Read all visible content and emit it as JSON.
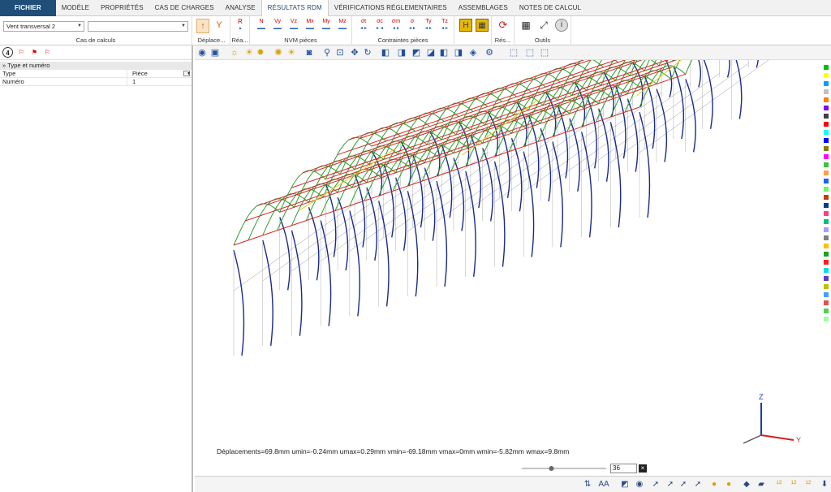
{
  "menu": {
    "tabs": [
      {
        "label": "FICHIER"
      },
      {
        "label": "MODÈLE"
      },
      {
        "label": "PROPRIÉTÉS"
      },
      {
        "label": "CAS DE CHARGES"
      },
      {
        "label": "ANALYSE"
      },
      {
        "label": "RÉSULTATS RDM"
      },
      {
        "label": "VÉRIFICATIONS RÉGLEMENTAIRES"
      },
      {
        "label": "ASSEMBLAGES"
      },
      {
        "label": "NOTES DE CALCUL"
      }
    ],
    "active_index": 5
  },
  "ribbon": {
    "load_case_combo": "Vent transversal 2",
    "second_combo": "",
    "groups": {
      "cas": "Cas de calculs",
      "deplacements": "Déplace...",
      "reactions": "Réa...",
      "nvm": "NVM pièces",
      "contraintes": "Contraintes pièces",
      "results": "Rés...",
      "outils": "Outils"
    },
    "nvm_icons": [
      "N",
      "Vy",
      "Vz",
      "Mx",
      "My",
      "Mz"
    ],
    "stress_icons": [
      "σt",
      "σc",
      "σm",
      "σ",
      "Ty",
      "Tz"
    ]
  },
  "left_panel": {
    "header": "Type et numéro",
    "rows": [
      {
        "key": "Type",
        "value": "Pièce"
      },
      {
        "key": "Numéro",
        "value": "1"
      }
    ]
  },
  "viewport": {
    "status": "Déplacements=69.8mm  umin=-0.24mm  umax=0.29mm  vmin=-69.18mm  vmax=0mm  wmin=-5.82mm  wmax=9.8mm",
    "zoom_value": "36",
    "axes": {
      "x": "Y",
      "z": "Z"
    },
    "slider_fraction": 0.35
  },
  "colors": {
    "rafter": "#2e9e2e",
    "purlin": "#d42a2a",
    "column": "#1a2a8a",
    "bracing": "#e0d020",
    "undeformed": "#9a9a9a"
  },
  "palette": [
    "#00c000",
    "#ffff00",
    "#00a0ff",
    "#c0c0c0",
    "#ff8000",
    "#8000ff",
    "#404040",
    "#ff0000",
    "#00ffff",
    "#0000ff",
    "#808000",
    "#ff00ff",
    "#40c040",
    "#ffa040",
    "#2060ff",
    "#60ff60",
    "#c04000",
    "#004080",
    "#ff4080",
    "#00c080",
    "#a0a0ff",
    "#808080",
    "#ffc000",
    "#20a020",
    "#ff2020",
    "#00e0e0",
    "#6040c0",
    "#c0c000",
    "#40a0ff",
    "#e05050",
    "#50d050",
    "#a0ffa0"
  ]
}
